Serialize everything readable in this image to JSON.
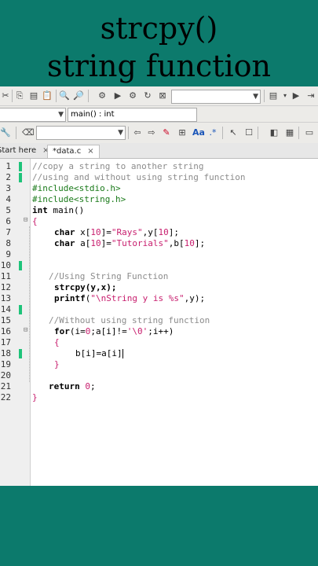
{
  "banner": {
    "line1": "strcpy()",
    "line2": "string function"
  },
  "toolbar": {
    "scope_combo": "",
    "function_combo": "main() : int",
    "search_combo": "",
    "icons": [
      "search-icon",
      "replace-icon",
      "settings-icon",
      "run-icon",
      "debug-icon",
      "stop-icon",
      "build-icon",
      "print-icon",
      "cut-icon",
      "copy-icon",
      "paste-icon"
    ]
  },
  "tabs": [
    {
      "label": "Start here",
      "close": "×"
    },
    {
      "label": "*data.c",
      "close": "×"
    }
  ],
  "line_numbers": [
    "1",
    "2",
    "3",
    "4",
    "5",
    "6",
    "7",
    "8",
    "9",
    "10",
    "11",
    "12",
    "13",
    "14",
    "15",
    "16",
    "17",
    "18",
    "19",
    "20",
    "21",
    "22"
  ],
  "code": {
    "l1": "//copy a string to another string",
    "l2": "//using and without using string function",
    "l3": "#include<stdio.h>",
    "l4": "#include<string.h>",
    "l5_kw": "int",
    "l5_rest": " main()",
    "l6": "{",
    "l7_kw": "char",
    "l7_a": " x[",
    "l7_n1": "10",
    "l7_b": "]=",
    "l7_s": "\"Rays\"",
    "l7_c": ",y[",
    "l7_n2": "10",
    "l7_d": "];",
    "l8_kw": "char",
    "l8_a": " a[",
    "l8_n1": "10",
    "l8_b": "]=",
    "l8_s": "\"Tutorials\"",
    "l8_c": ",b[",
    "l8_n2": "10",
    "l8_d": "];",
    "l10": "//Using String Function",
    "l11": "strcpy(y,x);",
    "l12_kw": "printf",
    "l12_a": "(",
    "l12_s": "\"\\nString y is %s\"",
    "l12_b": ",y);",
    "l14": "//Without using string function",
    "l15_kw": "for",
    "l15_a": "(i=",
    "l15_n": "0",
    "l15_b": ";a[i]!=",
    "l15_s": "'\\0'",
    "l15_c": ";i++)",
    "l16": "{",
    "l17": "b[i]=a[i]",
    "l18": "}",
    "l20_kw": "return",
    "l20_n": " 0",
    "l20_b": ";",
    "l21": "}"
  }
}
